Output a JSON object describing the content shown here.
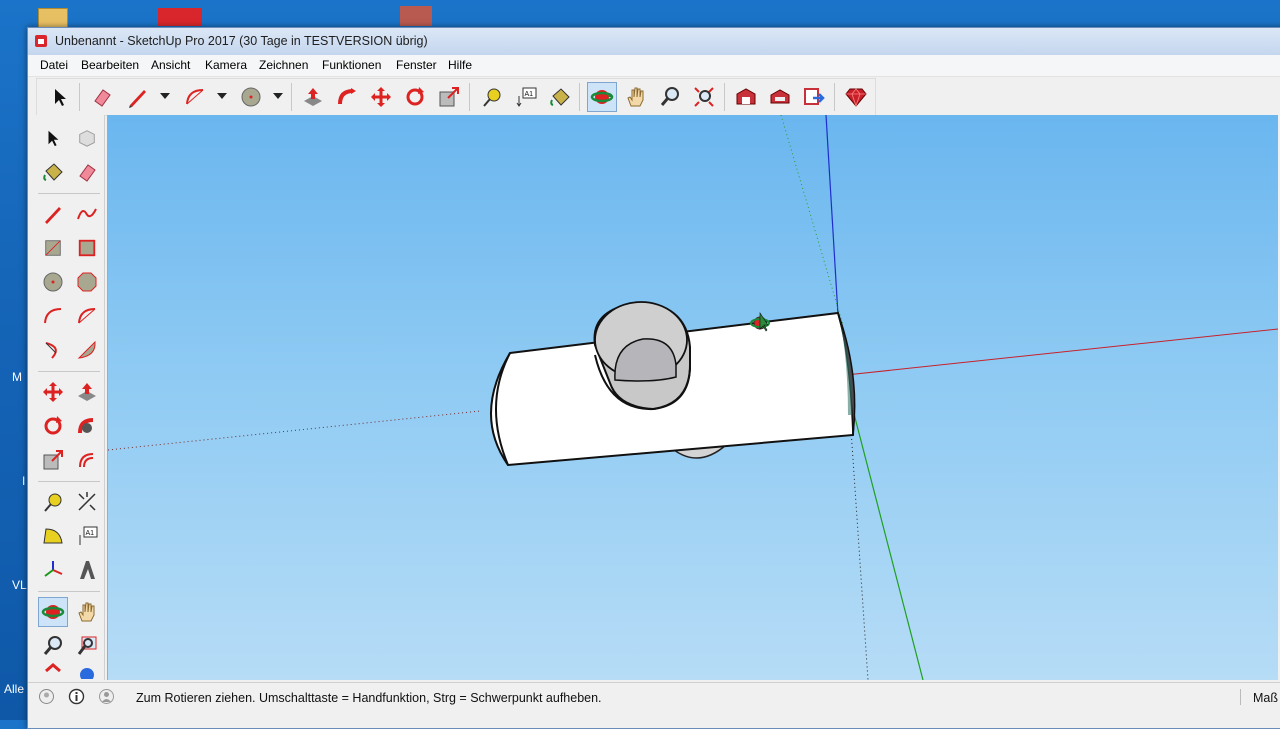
{
  "window": {
    "title": "Unbenannt - SketchUp Pro 2017 (30 Tage in TESTVERSION übrig)"
  },
  "menu": {
    "items": [
      "Datei",
      "Bearbeiten",
      "Ansicht",
      "Kamera",
      "Zeichnen",
      "Funktionen",
      "Fenster",
      "Hilfe"
    ]
  },
  "toolbar": {
    "tools": [
      "select-icon",
      "eraser-icon",
      "line-icon",
      "arc-icon",
      "circle-icon",
      "push-pull-icon",
      "follow-me-icon",
      "move-icon",
      "rotate-icon",
      "scale-icon",
      "tape-measure-icon",
      "text-icon",
      "paint-bucket-icon",
      "orbit-icon",
      "pan-icon",
      "zoom-icon",
      "zoom-extents-icon",
      "warehouse-icon",
      "extension-warehouse-icon",
      "share-model-icon",
      "ruby-icon"
    ],
    "active_tool": "orbit-icon"
  },
  "left_toolbar": {
    "active_tool": "orbit-icon",
    "text_tool_label": "A1"
  },
  "status": {
    "message": "Zum Rotieren ziehen. Umschalttaste = Handfunktion, Strg = Schwerpunkt aufheben.",
    "measure_label": "Maß"
  },
  "desktop": {
    "side_labels": [
      "M",
      "I",
      "VL",
      "Alle"
    ]
  },
  "colors": {
    "viewport_sky_top": "#6ab6ef",
    "axis_red": "#c8202a",
    "axis_green": "#1ea01e",
    "axis_blue": "#1e2ecc"
  }
}
